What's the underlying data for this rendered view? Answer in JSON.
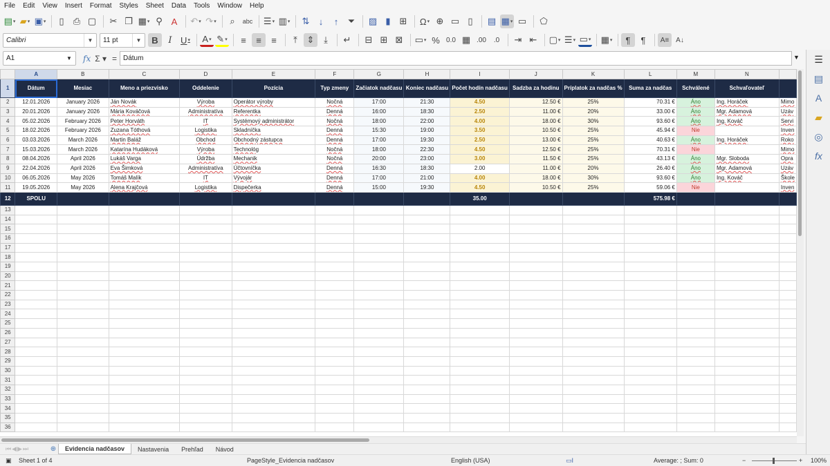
{
  "menu": [
    "File",
    "Edit",
    "View",
    "Insert",
    "Format",
    "Styles",
    "Sheet",
    "Data",
    "Tools",
    "Window",
    "Help"
  ],
  "font": {
    "name": "Calibri",
    "size": "11 pt"
  },
  "namebox": "A1",
  "formula": "Dátum",
  "columns": [
    "A",
    "B",
    "C",
    "D",
    "E",
    "F",
    "G",
    "H",
    "I",
    "J",
    "K",
    "L",
    "M",
    "N"
  ],
  "headers": [
    "Dátum",
    "Mesiac",
    "Meno a priezvisko",
    "Oddelenie",
    "Pozícia",
    "Typ zmeny",
    "Začiatok nadčasu",
    "Koniec nadčasu",
    "Počet hodín nadčasu",
    "Sadzba za hodinu",
    "Príplatok za nadčas %",
    "Suma za nadčas",
    "Schválené",
    "Schvaľovateľ"
  ],
  "rows": [
    {
      "date": "12.01.2026",
      "month": "January 2026",
      "name": "Ján Novák",
      "dept": "Výroba",
      "pos": "Operátor výroby",
      "shift": "Nočná",
      "start": "17:00",
      "end": "21:30",
      "hours": "4.50",
      "rate": "12.50 €",
      "pct": "25%",
      "sum": "70.31 €",
      "appr": "Áno",
      "approver": "Ing. Horáček",
      "note": "Mimo"
    },
    {
      "date": "20.01.2026",
      "month": "January 2026",
      "name": "Mária Kováčová",
      "dept": "Administratíva",
      "pos": "Referentka",
      "shift": "Denná",
      "start": "16:00",
      "end": "18:30",
      "hours": "2.50",
      "rate": "11.00 €",
      "pct": "20%",
      "sum": "33.00 €",
      "appr": "Áno",
      "approver": "Mgr. Adamová",
      "note": "Uzáv"
    },
    {
      "date": "05.02.2026",
      "month": "February 2026",
      "name": "Peter Horváth",
      "dept": "IT",
      "pos": "Systémový administrátor",
      "shift": "Nočná",
      "start": "18:00",
      "end": "22:00",
      "hours": "4.00",
      "rate": "18.00 €",
      "pct": "30%",
      "sum": "93.60 €",
      "appr": "Áno",
      "approver": "Ing. Kováč",
      "note": "Servi"
    },
    {
      "date": "18.02.2026",
      "month": "February 2026",
      "name": "Zuzana Tóthová",
      "dept": "Logistika",
      "pos": "Skladníčka",
      "shift": "Denná",
      "start": "15:30",
      "end": "19:00",
      "hours": "3.50",
      "rate": "10.50 €",
      "pct": "25%",
      "sum": "45.94 €",
      "appr": "Nie",
      "approver": "",
      "note": "Inven"
    },
    {
      "date": "03.03.2026",
      "month": "March 2026",
      "name": "Martin Baláž",
      "dept": "Obchod",
      "pos": "Obchodný zástupca",
      "shift": "Denná",
      "start": "17:00",
      "end": "19:30",
      "hours": "2.50",
      "rate": "13.00 €",
      "pct": "25%",
      "sum": "40.63 €",
      "appr": "Áno",
      "approver": "Ing. Horáček",
      "note": "Roko"
    },
    {
      "date": "15.03.2026",
      "month": "March 2026",
      "name": "Katarína Hudáková",
      "dept": "Výroba",
      "pos": "Technológ",
      "shift": "Nočná",
      "start": "18:00",
      "end": "22:30",
      "hours": "4.50",
      "rate": "12.50 €",
      "pct": "25%",
      "sum": "70.31 €",
      "appr": "Nie",
      "approver": "",
      "note": "Mimo"
    },
    {
      "date": "08.04.2026",
      "month": "April 2026",
      "name": "Lukáš Varga",
      "dept": "Údržba",
      "pos": "Mechanik",
      "shift": "Nočná",
      "start": "20:00",
      "end": "23:00",
      "hours": "3.00",
      "rate": "11.50 €",
      "pct": "25%",
      "sum": "43.13 €",
      "appr": "Áno",
      "approver": "Mgr. Sloboda",
      "note": "Opra"
    },
    {
      "date": "22.04.2026",
      "month": "April 2026",
      "name": "Eva Šimková",
      "dept": "Administratíva",
      "pos": "Účtovníčka",
      "shift": "Denná",
      "start": "16:30",
      "end": "18:30",
      "hours": "2.00",
      "rate": "11.00 €",
      "pct": "20%",
      "sum": "26.40 €",
      "appr": "Áno",
      "approver": "Mgr. Adamová",
      "note": "Uzáv"
    },
    {
      "date": "06.05.2026",
      "month": "May 2026",
      "name": "Tomáš Malík",
      "dept": "IT",
      "pos": "Vývojár",
      "shift": "Denná",
      "start": "17:00",
      "end": "21:00",
      "hours": "4.00",
      "rate": "18.00 €",
      "pct": "30%",
      "sum": "93.60 €",
      "appr": "Áno",
      "approver": "Ing. Kováč",
      "note": "Škole"
    },
    {
      "date": "19.05.2026",
      "month": "May 2026",
      "name": "Alena Krajčová",
      "dept": "Logistika",
      "pos": "Dispečerka",
      "shift": "Denná",
      "start": "15:00",
      "end": "19:30",
      "hours": "4.50",
      "rate": "10.50 €",
      "pct": "25%",
      "sum": "59.06 €",
      "appr": "Nie",
      "approver": "",
      "note": "Inven"
    }
  ],
  "total": {
    "label": "SPOLU",
    "hours": "35.00",
    "sum": "575.98 €"
  },
  "sheets": [
    "Evidencia nadčasov",
    "Nastavenia",
    "Prehľad",
    "Návod"
  ],
  "status": {
    "sheet": "Sheet 1 of 4",
    "style": "PageStyle_Evidencia nadčasov",
    "lang": "English (USA)",
    "calc": "Average: ; Sum: 0",
    "zoom": "100%"
  }
}
